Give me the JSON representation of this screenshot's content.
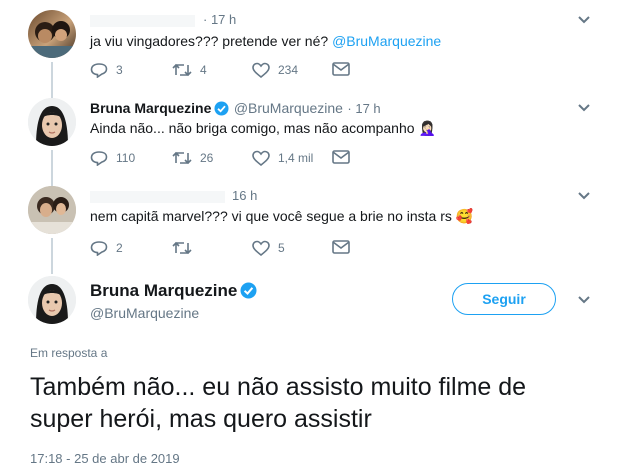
{
  "tweet1": {
    "time": "· 17 h",
    "text": "ja viu vingadores??? pretende ver né?",
    "mention": "@BruMarquezine",
    "replies": "3",
    "retweets": "4",
    "likes": "234"
  },
  "tweet2": {
    "name": "Bruna Marquezine",
    "handle": "@BruMarquezine",
    "time": "· 17 h",
    "text": "Ainda não... não briga comigo, mas não acompanho",
    "emoji": "🤦🏻‍♀️",
    "replies": "110",
    "retweets": "26",
    "likes": "1,4 mil"
  },
  "tweet3": {
    "time": "16 h",
    "text": "nem capitã marvel??? vi que você segue a brie no insta rs",
    "emoji": "🥰",
    "replies": "2",
    "retweets": "",
    "likes": "5"
  },
  "main": {
    "name": "Bruna Marquezine",
    "handle": "@BruMarquezine",
    "follow_label": "Seguir",
    "reply_to": "Em resposta a",
    "text_line1": "Também não... eu não assisto muito filme de",
    "text_line2": "super herói, mas quero assistir",
    "timestamp": "17:18 - 25 de abr de 2019"
  },
  "colors": {
    "accent": "#1da1f2",
    "muted": "#657786",
    "line": "#ccd6dd",
    "verified": "#1da1f2"
  }
}
